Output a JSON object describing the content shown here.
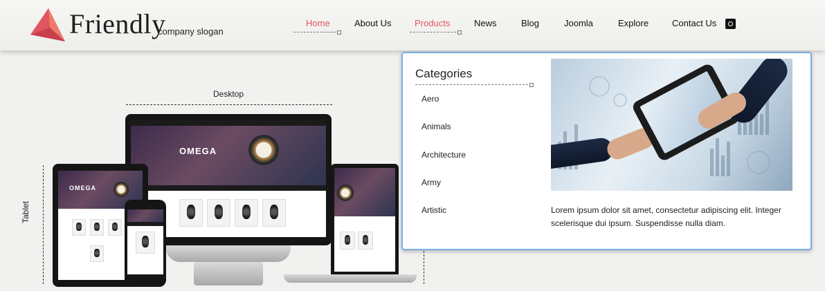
{
  "brand": {
    "name": "Friendly",
    "slogan": "company slogan",
    "accent_color": "#e0565f",
    "logo_icon": "triangle-logo-icon"
  },
  "nav": {
    "items": [
      {
        "label": "Home",
        "active": true
      },
      {
        "label": "About Us",
        "active": false
      },
      {
        "label": "Products",
        "active": true
      },
      {
        "label": "News",
        "active": false
      },
      {
        "label": "Blog",
        "active": false
      },
      {
        "label": "Joomla",
        "active": false
      },
      {
        "label": "Explore",
        "active": false
      },
      {
        "label": "Contact Us",
        "active": false
      }
    ],
    "search_icon": "search-icon"
  },
  "hero": {
    "desktop_label": "Desktop",
    "tablet_label": "Tablet",
    "screen_brand": "OMEGA"
  },
  "dropdown": {
    "title": "Categories",
    "categories": [
      "Aero",
      "Animals",
      "Architecture",
      "Army",
      "Artistic"
    ],
    "description": "Lorem ipsum dolor sit amet, consectetur adipiscing elit. Integer scelerisque dui ipsum. Suspendisse nulla diam.",
    "border_color": "#79aee6"
  }
}
